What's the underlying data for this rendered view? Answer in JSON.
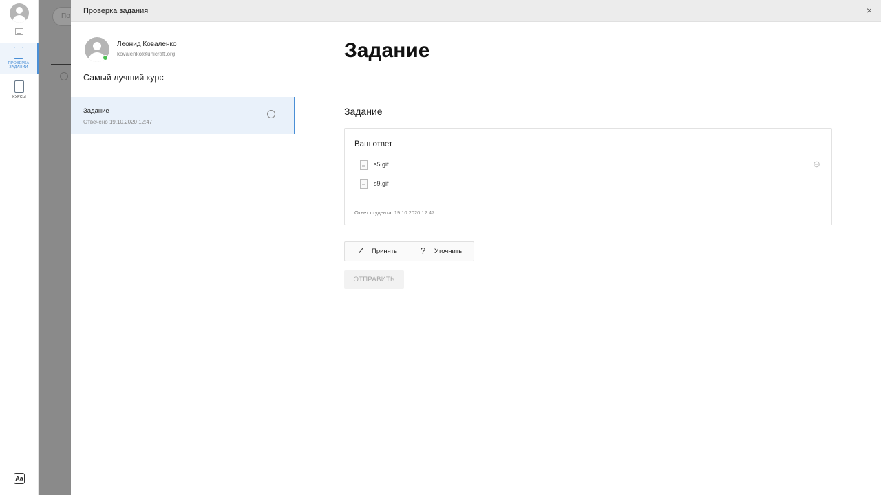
{
  "rail": {
    "items": [
      {
        "label": "ПРОВЕРКА ЗАДАНИЙ",
        "icon": "assignment-check-icon",
        "active": true
      },
      {
        "label": "КУРСЫ",
        "icon": "book-icon",
        "active": false
      }
    ],
    "font_icon_text": "Aa"
  },
  "backdrop": {
    "search_text": "По"
  },
  "modal": {
    "title": "Проверка задания",
    "close_glyph": "×"
  },
  "student": {
    "name": "Леонид Коваленко",
    "email": "kovalenko@unicraft.org",
    "status_color": "#4bbf52"
  },
  "course": {
    "title": "Самый лучший курс"
  },
  "task_list": [
    {
      "title": "Задание",
      "subtitle": "Отвечено 19.10.2020 12:47"
    }
  ],
  "main": {
    "title": "Задание",
    "section_title": "Задание",
    "answer": {
      "label": "Ваш ответ",
      "files": [
        "s5.gif",
        "s9.gif"
      ],
      "meta_label": "Ответ студента.",
      "meta_date": "19.10.2020 12:47"
    },
    "decision": {
      "accept_label": "Принять",
      "clarify_label": "Уточнить"
    },
    "send_label": "ОТПРАВИТЬ"
  },
  "colors": {
    "accent": "#4a8fd6",
    "active_bg": "#e9f1fa",
    "header_bg": "#ececec"
  }
}
